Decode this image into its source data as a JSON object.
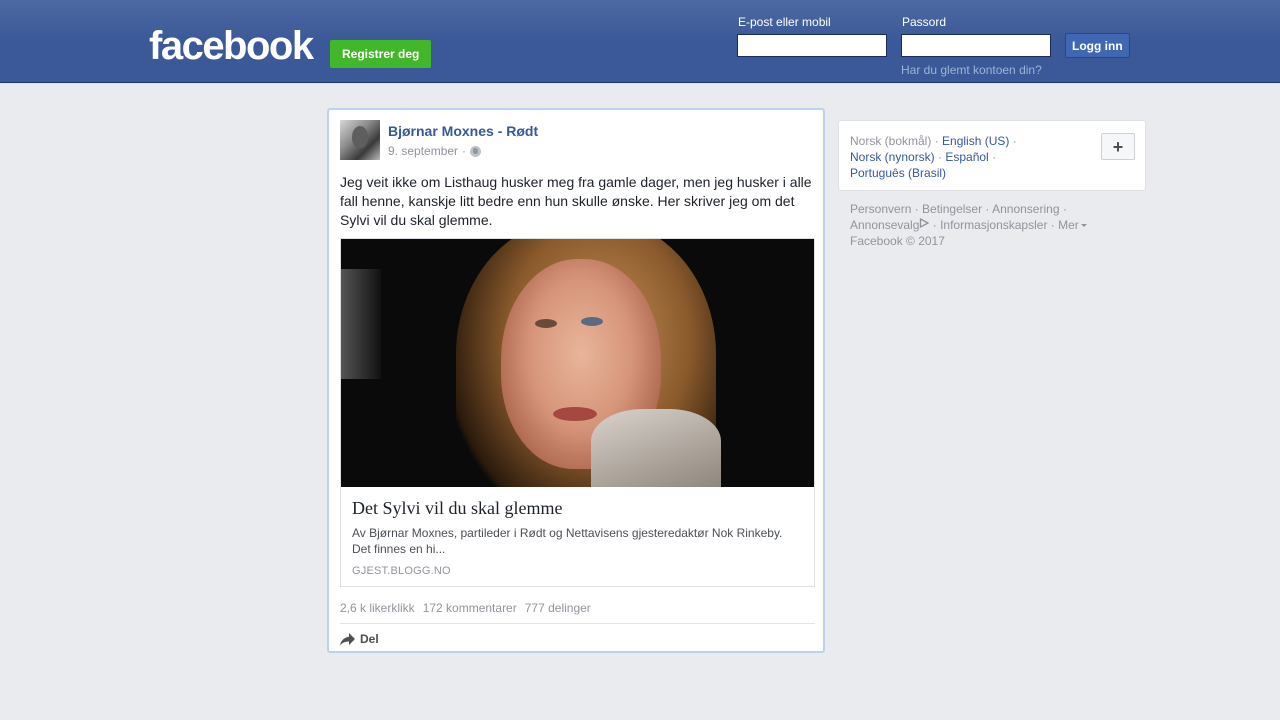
{
  "header": {
    "logo": "facebook",
    "register_label": "Registrer deg",
    "email_label": "E-post eller mobil",
    "password_label": "Passord",
    "login_label": "Logg inn",
    "forgot_label": "Har du glemt kontoen din?"
  },
  "post": {
    "author": "Bjørnar Moxnes - Rødt",
    "date": "9. september",
    "separator": "·",
    "privacy_icon": "globe-icon",
    "text": "Jeg veit ikke om Listhaug husker meg fra gamle dager, men jeg husker i alle fall henne, kanskje litt bedre enn hun skulle ønske. Her skriver jeg om det Sylvi vil du skal glemme.",
    "link": {
      "title": "Det Sylvi vil du skal glemme",
      "description": "Av Bjørnar Moxnes, partileder i Rødt og Nettavisens gjesteredaktør Nok Rinkeby. Det finnes en hi...",
      "domain": "GJEST.BLOGG.NO"
    },
    "stats": {
      "likes": "2,6 k likerklikk",
      "comments": "172 kommentarer",
      "shares": "777 delinger"
    },
    "share_label": "Del"
  },
  "languages": {
    "current": "Norsk (bokmål)",
    "options": [
      "English (US)",
      "Norsk (nynorsk)",
      "Español",
      "Português (Brasil)"
    ],
    "add_label": "+"
  },
  "footer": {
    "privacy": "Personvern",
    "terms": "Betingelser",
    "advertising": "Annonsering",
    "ad_choices": "Annonsevalg",
    "cookies": "Informasjonskapsler",
    "more": "Mer",
    "copyright": "Facebook © 2017"
  },
  "colors": {
    "brand_blue": "#3b5998",
    "register_green": "#42b72a",
    "link_blue": "#365899",
    "page_bg": "#e9ebee"
  }
}
